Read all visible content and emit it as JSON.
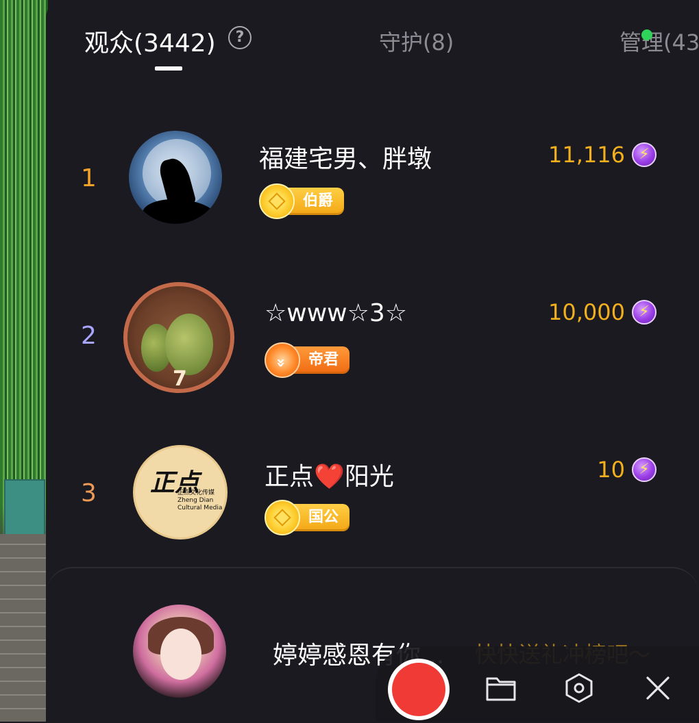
{
  "tabs": {
    "audience": "观众(3442)",
    "guard": "守护(8)",
    "admin": "管理(43"
  },
  "help_icon": "?",
  "rows": [
    {
      "rank": "1",
      "rank_color": "#f2a22a",
      "name": "福建宅男、胖墩",
      "score": "11,116",
      "badge": "伯爵",
      "badge_style": "gold"
    },
    {
      "rank": "2",
      "rank_color": "#a9a6ff",
      "name": "☆www☆3☆",
      "score": "10,000",
      "badge": "帝君",
      "badge_style": "orange",
      "avatar_number": "7"
    },
    {
      "rank": "3",
      "rank_color": "#ee9b57",
      "name": "正点❤️阳光",
      "score": "10",
      "badge": "国公",
      "badge_style": "gold",
      "avatar_logo_big": "正点",
      "avatar_logo_small": "正点文化传媒 Zheng Dian Cultural Media"
    }
  ],
  "coin_icon": "⚡",
  "me": {
    "text": "婷婷感恩有你...",
    "cta": "快快送礼冲榜吧～"
  },
  "toolbar": {
    "record_button": "record-button",
    "folder_icon": "folder-icon",
    "settings_icon": "hexagon-settings-icon",
    "close_icon": "close-icon"
  },
  "colors": {
    "background": "#1b1a20",
    "score": "#f2b01e",
    "cta": "#a67a1e",
    "record": "#ef3a35",
    "online": "#2fd35a"
  }
}
